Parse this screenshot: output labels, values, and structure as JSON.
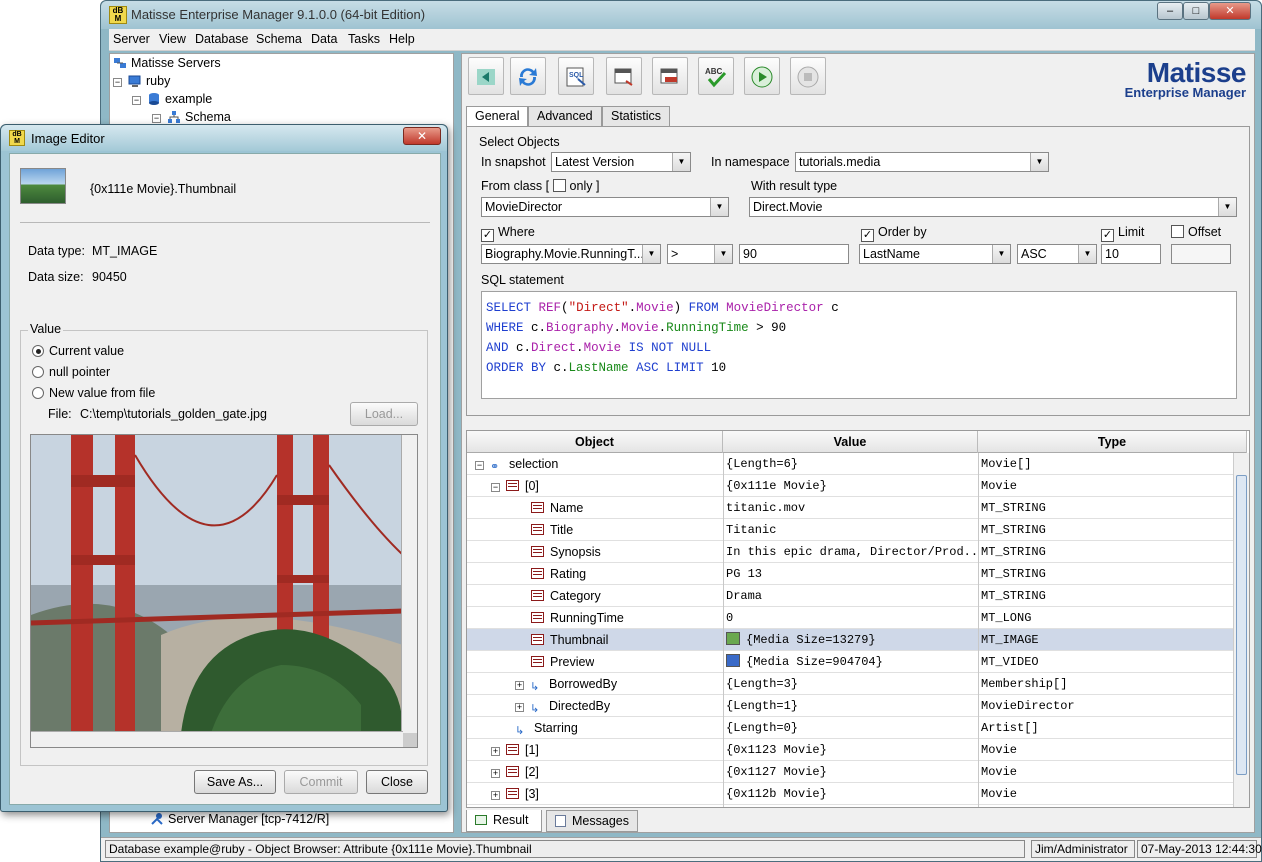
{
  "window": {
    "title": "Matisse Enterprise Manager 9.1.0.0 (64-bit Edition)",
    "close_glyph": "✕",
    "max_glyph": "□",
    "min_glyph": "–"
  },
  "menu": [
    "Server",
    "View",
    "Database",
    "Schema",
    "Data",
    "Tasks",
    "Help"
  ],
  "tree": {
    "root": "Matisse Servers",
    "server": "ruby",
    "database": "example",
    "schema": "Schema",
    "server_manager": "Server Manager [tcp-7412/R]"
  },
  "toolbar": {
    "buttons": [
      "back",
      "refresh",
      "sql",
      "export",
      "import",
      "spellcheck",
      "run",
      "stop"
    ],
    "logo_title": "Matisse",
    "logo_subtitle": "Enterprise Manager"
  },
  "tabs": [
    "General",
    "Advanced",
    "Statistics"
  ],
  "query": {
    "group_label": "Select Objects",
    "snapshot_label": "In snapshot",
    "snapshot_value": "Latest Version",
    "namespace_label": "In namespace",
    "namespace_value": "tutorials.media",
    "from_class_label_pre": "From class [",
    "only_label": "only ]",
    "result_type_label": "With result type",
    "from_class_value": "MovieDirector",
    "result_type_value": "Direct.Movie",
    "where_label": "Where",
    "order_by_label": "Order by",
    "limit_label": "Limit",
    "offset_label": "Offset",
    "where_attr": "Biography.Movie.RunningT...",
    "where_op": ">",
    "where_value": "90",
    "order_attr": "LastName",
    "order_dir": "ASC",
    "limit_value": "10",
    "offset_value": "",
    "sql_label": "SQL statement"
  },
  "sql_tokens": {
    "l1": [
      "SELECT",
      " ",
      "REF",
      "(",
      "\"Direct\"",
      ".",
      "Movie",
      ")",
      " ",
      "FROM",
      " ",
      "MovieDirector",
      " c"
    ],
    "l2": [
      "WHERE",
      " c.",
      "Biography",
      ".",
      "Movie",
      ".",
      "RunningTime",
      " > 90"
    ],
    "l3": [
      "AND",
      " c.",
      "Direct",
      ".",
      "Movie",
      " ",
      "IS NOT NULL"
    ],
    "l4": [
      "ORDER BY",
      " c.",
      "LastName",
      " ",
      "ASC",
      " ",
      "LIMIT",
      " 10"
    ]
  },
  "result": {
    "columns": [
      "Object",
      "Value",
      "Type"
    ],
    "rows": [
      {
        "obj": "selection",
        "val": "{Length=6}",
        "type": "Movie[]"
      },
      {
        "obj": "[0]",
        "val": "{0x111e Movie}",
        "type": "Movie"
      },
      {
        "obj": "Name",
        "val": "titanic.mov",
        "type": "MT_STRING"
      },
      {
        "obj": "Title",
        "val": "Titanic",
        "type": "MT_STRING"
      },
      {
        "obj": "Synopsis",
        "val": "In this epic drama, Director/Prod...",
        "type": "MT_STRING"
      },
      {
        "obj": "Rating",
        "val": "PG 13",
        "type": "MT_STRING"
      },
      {
        "obj": "Category",
        "val": "Drama",
        "type": "MT_STRING"
      },
      {
        "obj": "RunningTime",
        "val": "0",
        "type": "MT_LONG"
      },
      {
        "obj": "Thumbnail",
        "val": "{Media Size=13279}",
        "type": "MT_IMAGE"
      },
      {
        "obj": "Preview",
        "val": "{Media Size=904704}",
        "type": "MT_VIDEO"
      },
      {
        "obj": "BorrowedBy",
        "val": "{Length=3}",
        "type": "Membership[]"
      },
      {
        "obj": "DirectedBy",
        "val": "{Length=1}",
        "type": "MovieDirector"
      },
      {
        "obj": "Starring",
        "val": "{Length=0}",
        "type": "Artist[]"
      },
      {
        "obj": "[1]",
        "val": "{0x1123 Movie}",
        "type": "Movie"
      },
      {
        "obj": "[2]",
        "val": "{0x1127 Movie}",
        "type": "Movie"
      },
      {
        "obj": "[3]",
        "val": "{0x112b Movie}",
        "type": "Movie"
      }
    ]
  },
  "bottom_tabs": [
    "Result",
    "Messages"
  ],
  "status": {
    "message": "Database example@ruby - Object Browser: Attribute {0x111e Movie}.Thumbnail",
    "user": "Jim/Administrator",
    "datetime": "07-May-2013 12:44:30"
  },
  "image_editor": {
    "title": "Image Editor",
    "close_glyph": "✕",
    "object_name": "{0x111e Movie}.Thumbnail",
    "data_type_label": "Data type:",
    "data_type_value": "MT_IMAGE",
    "data_size_label": "Data size:",
    "data_size_value": "90450",
    "value_group_label": "Value",
    "options": [
      "Current value",
      "null pointer",
      "New value from file"
    ],
    "selected_option": 0,
    "file_label": "File:",
    "file_value": "C:\\temp\\tutorials_golden_gate.jpg",
    "load_button": "Load...",
    "save_as_button": "Save As...",
    "commit_button": "Commit",
    "close_button": "Close"
  },
  "colors": {
    "bridge": "#c0392b",
    "sky": "#c8d4e0",
    "keyword": "#1f3fcf",
    "function": "#aa22aa",
    "string": "#c41a16",
    "attribute": "#1a8a1a"
  }
}
